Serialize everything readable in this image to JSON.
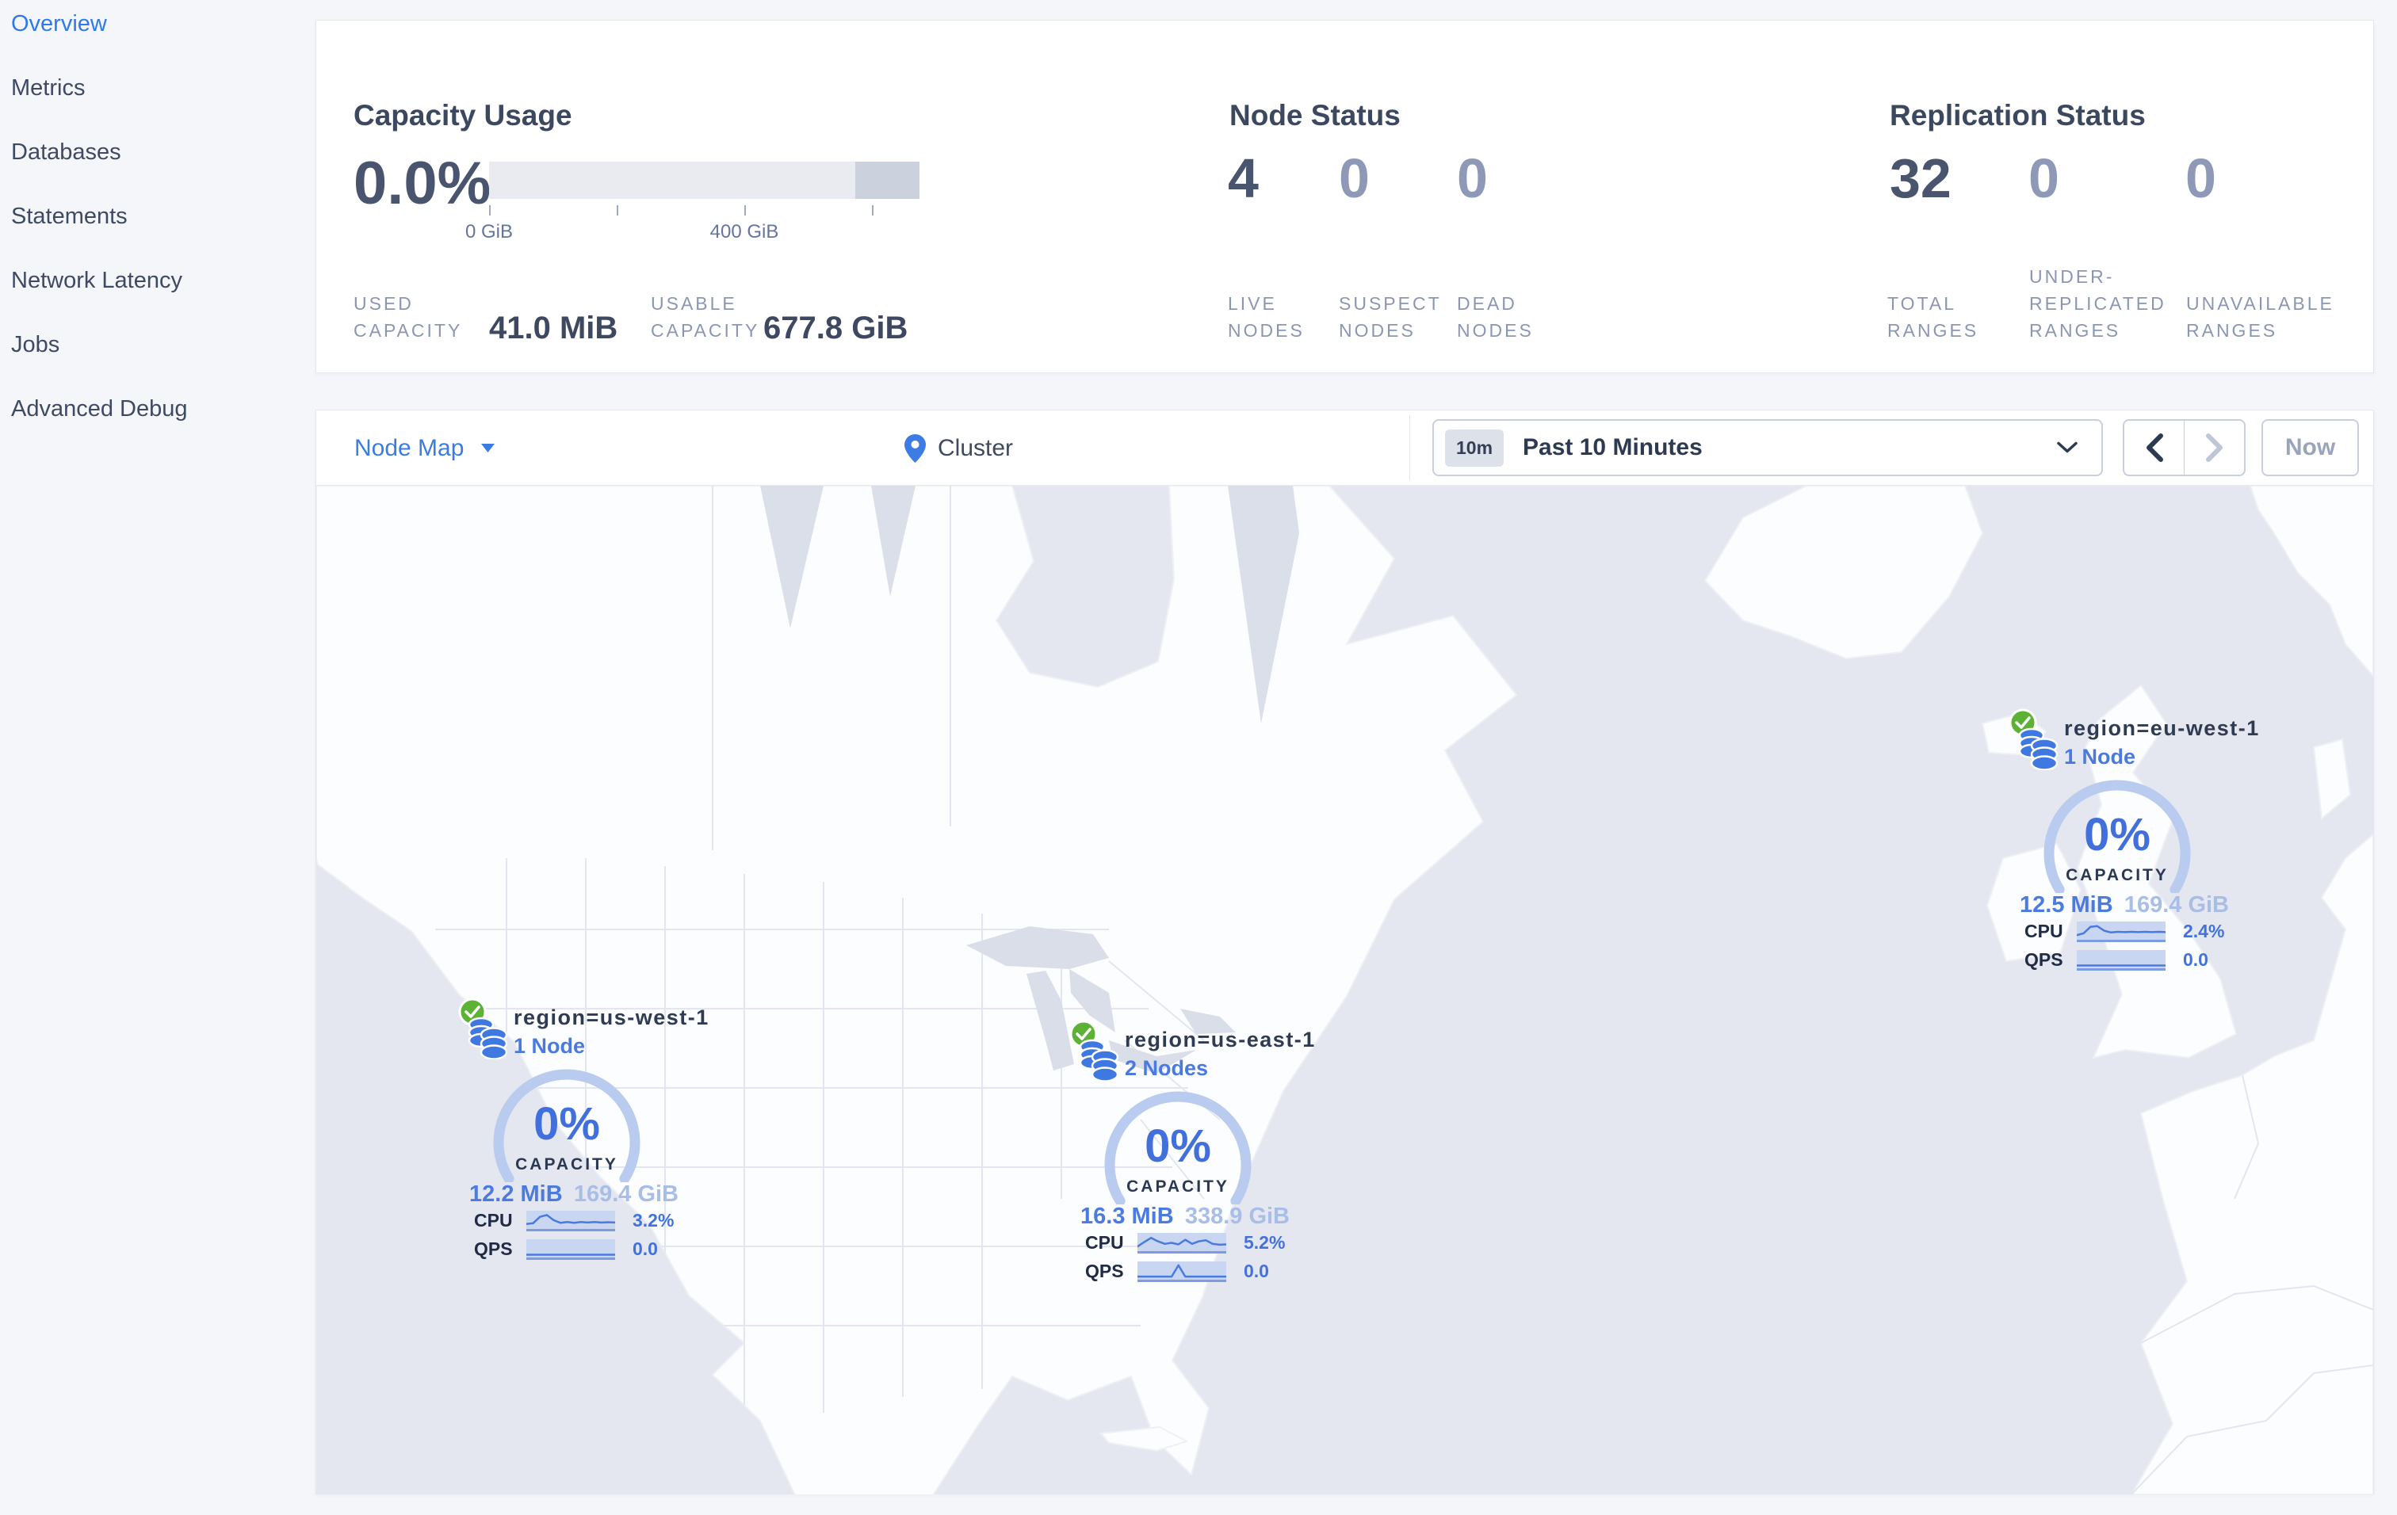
{
  "sidebar": {
    "items": [
      {
        "label": "Overview",
        "active": true
      },
      {
        "label": "Metrics",
        "active": false
      },
      {
        "label": "Databases",
        "active": false
      },
      {
        "label": "Statements",
        "active": false
      },
      {
        "label": "Network Latency",
        "active": false
      },
      {
        "label": "Jobs",
        "active": false
      },
      {
        "label": "Advanced Debug",
        "active": false
      }
    ]
  },
  "summary": {
    "capacity": {
      "title": "Capacity Usage",
      "percent": "0.0%",
      "axis_ticks": [
        "0 GiB",
        "400 GiB"
      ],
      "used": {
        "label": "USED\nCAPACITY",
        "value": "41.0 MiB"
      },
      "usable": {
        "label": "USABLE\nCAPACITY",
        "value": "677.8 GiB"
      }
    },
    "node_status": {
      "title": "Node Status",
      "stats": [
        {
          "value": "4",
          "label": "LIVE\nNODES"
        },
        {
          "value": "0",
          "label": "SUSPECT\nNODES"
        },
        {
          "value": "0",
          "label": "DEAD\nNODES"
        }
      ]
    },
    "replication": {
      "title": "Replication Status",
      "stats": [
        {
          "value": "32",
          "label": "TOTAL\nRANGES"
        },
        {
          "value": "0",
          "label": "UNDER-\nREPLICATED\nRANGES"
        },
        {
          "value": "0",
          "label": "UNAVAILABLE\nRANGES"
        }
      ]
    }
  },
  "toolbar": {
    "view_label": "Node Map",
    "breadcrumb": "Cluster",
    "time": {
      "badge": "10m",
      "range": "Past 10 Minutes"
    },
    "now_label": "Now"
  },
  "map": {
    "nodes": [
      {
        "id": "us-west-1",
        "region": "region=us-west-1",
        "nodes_label": "1 Node",
        "percent": "0%",
        "capacity_label": "CAPACITY",
        "used": "12.2 MiB",
        "capacity": "169.4 GiB",
        "cpu_label": "CPU",
        "cpu_value": "3.2%",
        "qps_label": "QPS",
        "qps_value": "0.0",
        "cpu_spark": [
          0.78,
          0.72,
          0.3,
          0.18,
          0.52,
          0.7,
          0.64,
          0.7,
          0.64,
          0.68,
          0.64,
          0.68,
          0.66,
          0.68
        ],
        "qps_spark": [
          0.92,
          0.92,
          0.92,
          0.92,
          0.92,
          0.92,
          0.92,
          0.92,
          0.92,
          0.92,
          0.92,
          0.92,
          0.92,
          0.92
        ]
      },
      {
        "id": "us-east-1",
        "region": "region=us-east-1",
        "nodes_label": "2 Nodes",
        "percent": "0%",
        "capacity_label": "CAPACITY",
        "used": "16.3 MiB",
        "capacity": "338.9 GiB",
        "cpu_label": "CPU",
        "cpu_value": "5.2%",
        "qps_label": "QPS",
        "qps_value": "0.0",
        "cpu_spark": [
          0.8,
          0.5,
          0.22,
          0.45,
          0.62,
          0.55,
          0.66,
          0.35,
          0.62,
          0.45,
          0.38,
          0.62,
          0.68,
          0.66
        ],
        "qps_spark": [
          0.9,
          0.9,
          0.9,
          0.9,
          0.9,
          0.9,
          0.15,
          0.9,
          0.9,
          0.9,
          0.9,
          0.9,
          0.9,
          0.9
        ]
      },
      {
        "id": "eu-west-1",
        "region": "region=eu-west-1",
        "nodes_label": "1 Node",
        "percent": "0%",
        "capacity_label": "CAPACITY",
        "used": "12.5 MiB",
        "capacity": "169.4 GiB",
        "cpu_label": "CPU",
        "cpu_value": "2.4%",
        "qps_label": "QPS",
        "qps_value": "0.0",
        "cpu_spark": [
          0.8,
          0.68,
          0.25,
          0.2,
          0.5,
          0.62,
          0.58,
          0.6,
          0.58,
          0.6,
          0.58,
          0.6,
          0.58,
          0.6
        ],
        "qps_spark": [
          0.92,
          0.92,
          0.92,
          0.92,
          0.92,
          0.92,
          0.92,
          0.92,
          0.92,
          0.92,
          0.92,
          0.92,
          0.92,
          0.92
        ]
      }
    ]
  },
  "colors": {
    "accent_blue": "#3a7ce4",
    "node_blue": "#4170dd",
    "gauge_arc": "#b9cbee",
    "status_green": "#5bb234",
    "ocean": "#e4e7ef",
    "land": "#fcfdfe",
    "dark_text": "#3c4760",
    "muted_text": "#8a96b2"
  }
}
